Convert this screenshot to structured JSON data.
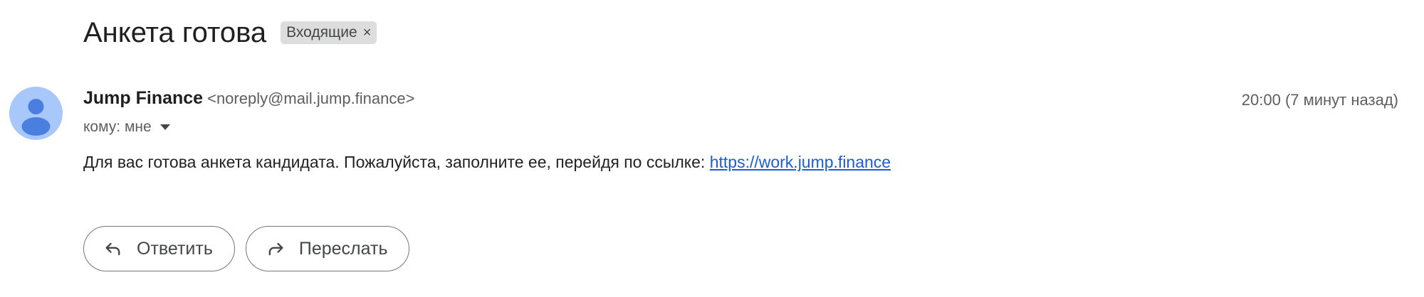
{
  "email": {
    "subject": "Анкета готова",
    "label_chip": {
      "text": "Входящие",
      "close_glyph": "×"
    },
    "sender": {
      "name": "Jump Finance",
      "email": "<noreply@mail.jump.finance>",
      "avatar_icon": "person-icon",
      "avatar_color": "#a8c7fa"
    },
    "timestamp": "20:00 (7 минут назад)",
    "recipient": "кому: мне",
    "body": {
      "text": "Для вас готова анкета кандидата. Пожалуйста, заполните ее, перейдя по ссылке: ",
      "link_text": "https://work.jump.finance",
      "link_color": "#1a5fd0"
    }
  },
  "actions": {
    "reply": {
      "label": "Ответить",
      "icon": "reply-icon"
    },
    "forward": {
      "label": "Переслать",
      "icon": "forward-icon"
    }
  }
}
